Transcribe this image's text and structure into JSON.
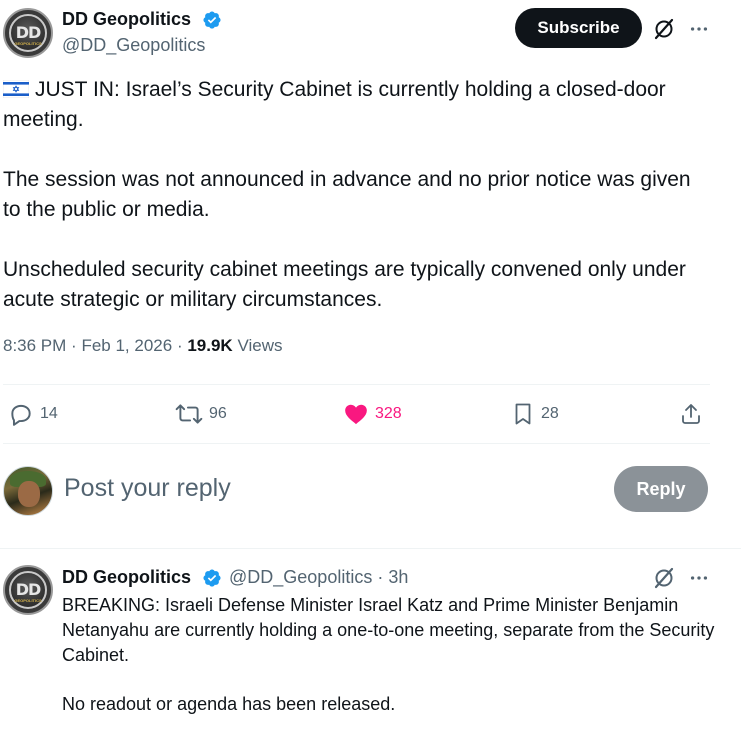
{
  "author": {
    "name": "DD Geopolitics",
    "handle": "@DD_Geopolitics",
    "avatar_letters": "DD",
    "avatar_sub": "GEOPOLITICS"
  },
  "header": {
    "subscribe_label": "Subscribe",
    "more_label": "···"
  },
  "tweet": {
    "para1": "JUST IN: Israel’s Security Cabinet is currently holding a closed-door meeting.",
    "para2": "The session was not announced in advance and no prior notice was given to the public or media.",
    "para3": "Unscheduled security cabinet meetings are typically convened only under acute strategic or military circumstances.",
    "time": "8:36 PM",
    "sep": "·",
    "date": "Feb 1, 2026",
    "views_count": "19.9K",
    "views_label": "Views"
  },
  "actions": {
    "replies": "14",
    "reposts": "96",
    "likes": "328",
    "bookmarks": "28"
  },
  "composer": {
    "placeholder": "Post your reply",
    "reply_label": "Reply"
  },
  "reply_tweet": {
    "name": "DD Geopolitics",
    "handle": "@DD_Geopolitics",
    "sep": "·",
    "age": "3h",
    "para1": "BREAKING: Israeli Defense Minister Israel Katz and Prime Minister Benjamin Netanyahu are currently holding a one-to-one meeting, separate from the Security Cabinet.",
    "para2": "No readout or agenda has been released."
  },
  "colors": {
    "accent": "#1d9bf0",
    "like": "#f91880",
    "text": "#0f1419",
    "secondary": "#536471"
  },
  "icons": [
    "verified-badge-icon",
    "grok-slash-icon",
    "more-icon",
    "reply-icon",
    "repost-icon",
    "heart-icon",
    "bookmark-icon",
    "share-icon",
    "israel-flag-icon"
  ]
}
